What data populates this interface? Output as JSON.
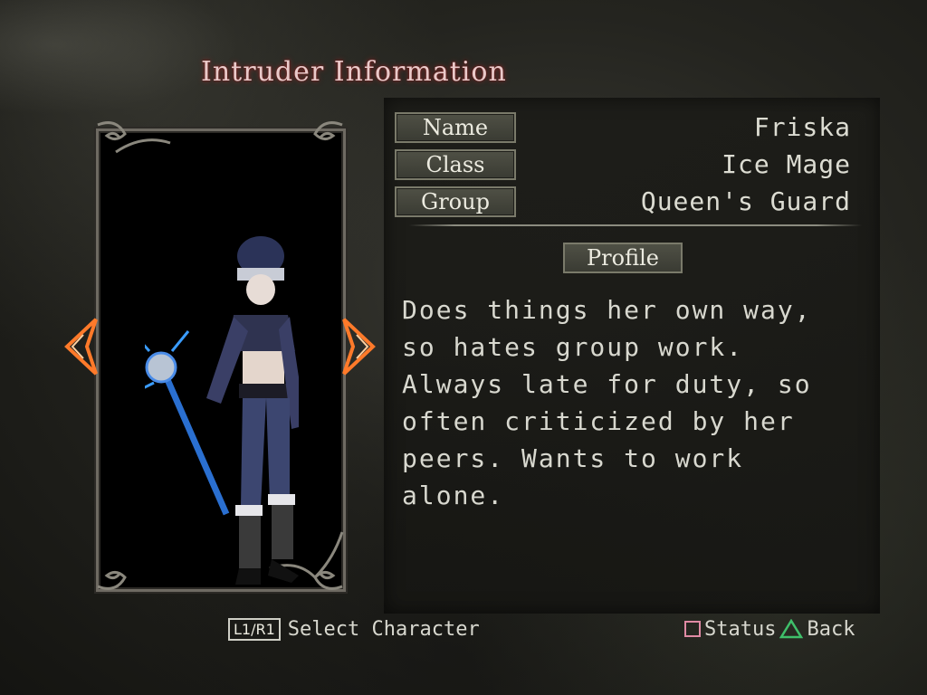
{
  "screen": {
    "title": "Intruder Information"
  },
  "character": {
    "fields": [
      {
        "label": "Name",
        "value": "Friska"
      },
      {
        "label": "Class",
        "value": "Ice Mage"
      },
      {
        "label": "Group",
        "value": "Queen's Guard"
      }
    ],
    "profile_label": "Profile",
    "profile_text": "Does things her own way, so hates group work. Always late for duty, so often criticized by her peers. Wants to work alone."
  },
  "footer": {
    "select_key": "L1/R1",
    "select_label": "Select Character",
    "status_icon": "square-icon",
    "status_label": "Status",
    "back_icon": "triangle-icon",
    "back_label": "Back"
  },
  "colors": {
    "title_glow": "#c03030",
    "arrow": "#ff7a2a",
    "status_square": "#e08aa4",
    "back_triangle": "#3fbf6a"
  }
}
